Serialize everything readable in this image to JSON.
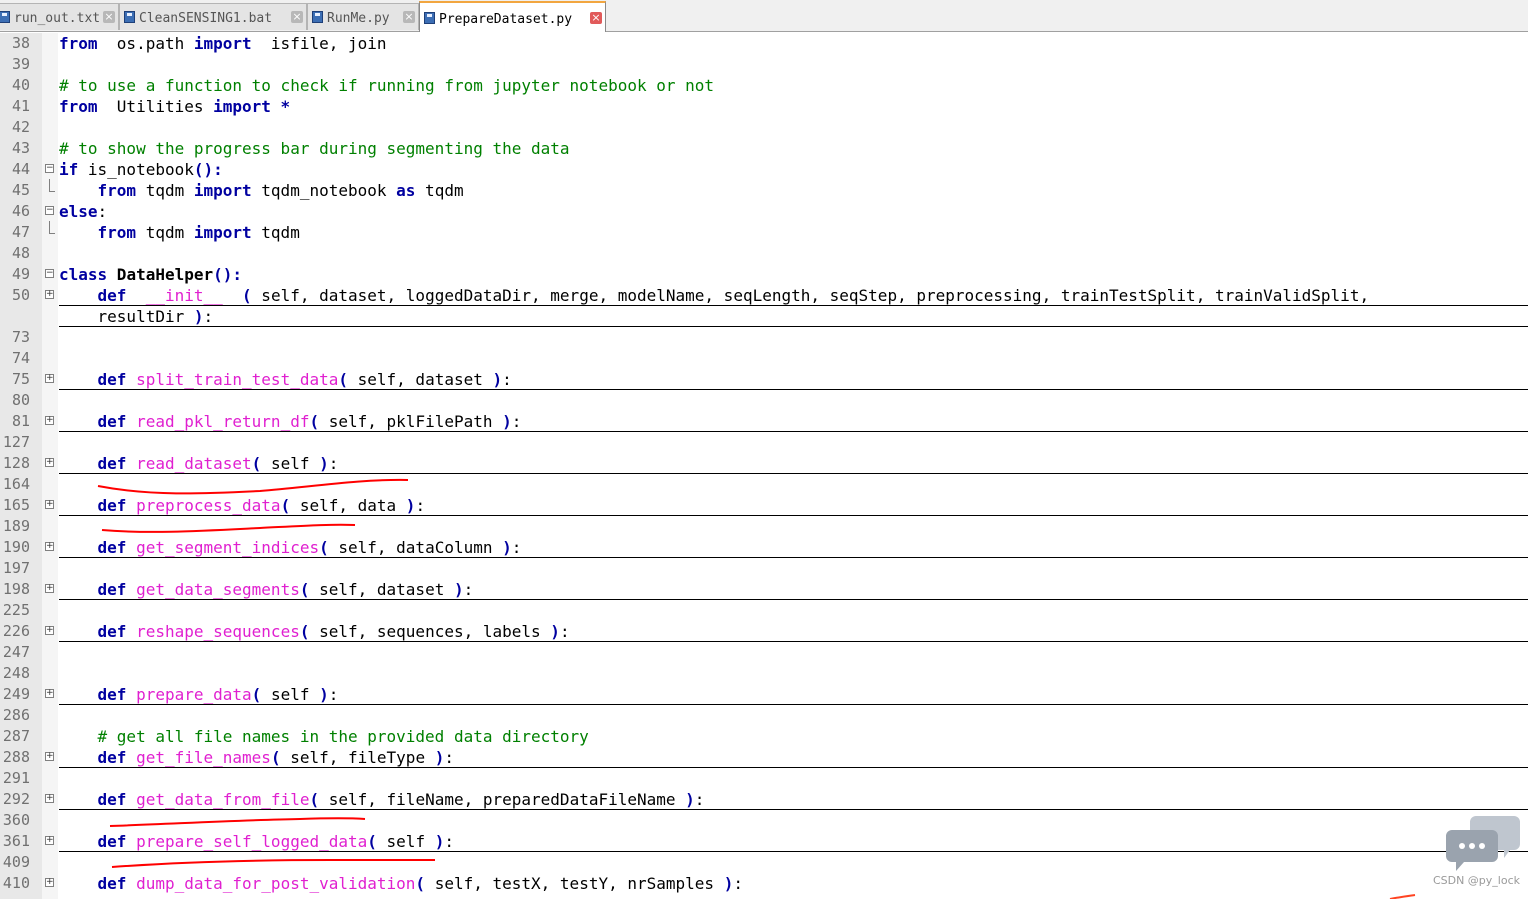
{
  "tabs": [
    {
      "label": "run_out.txt",
      "active": false
    },
    {
      "label": "CleanSENSING1.bat",
      "active": false
    },
    {
      "label": "RunMe.py",
      "active": false
    },
    {
      "label": "PrepareDataset.py",
      "active": true
    }
  ],
  "lines": [
    {
      "num": "38",
      "code": [
        [
          "kw",
          "from"
        ],
        [
          "",
          "  os.path "
        ],
        [
          "kw",
          "import"
        ],
        [
          "",
          "  isfile, join"
        ]
      ]
    },
    {
      "num": "39",
      "code": []
    },
    {
      "num": "40",
      "code": [
        [
          "cm",
          "# to use a function to check if running from jupyter notebook or not"
        ]
      ]
    },
    {
      "num": "41",
      "code": [
        [
          "kw",
          "from"
        ],
        [
          "",
          "  Utilities "
        ],
        [
          "kw",
          "import"
        ],
        [
          "",
          ""
        ],
        [
          "kw",
          " *"
        ]
      ]
    },
    {
      "num": "42",
      "code": []
    },
    {
      "num": "43",
      "code": [
        [
          "cm",
          "# to show the progress bar during segmenting the data"
        ]
      ]
    },
    {
      "num": "44",
      "fold": "open",
      "code": [
        [
          "kw",
          "if"
        ],
        [
          "",
          " is_notebook"
        ],
        [
          "kw",
          "():"
        ]
      ]
    },
    {
      "num": "45",
      "fold": "end",
      "code": [
        [
          "",
          "    "
        ],
        [
          "kw",
          "from"
        ],
        [
          "",
          " tqdm "
        ],
        [
          "kw",
          "import"
        ],
        [
          "",
          " tqdm_notebook "
        ],
        [
          "kw",
          "as"
        ],
        [
          "",
          " tqdm"
        ]
      ]
    },
    {
      "num": "46",
      "fold": "open",
      "code": [
        [
          "kw",
          "else"
        ],
        [
          "",
          ":"
        ]
      ]
    },
    {
      "num": "47",
      "fold": "end",
      "code": [
        [
          "",
          "    "
        ],
        [
          "kw",
          "from"
        ],
        [
          "",
          " tqdm "
        ],
        [
          "kw",
          "import"
        ],
        [
          "",
          " tqdm"
        ]
      ]
    },
    {
      "num": "48",
      "code": []
    },
    {
      "num": "49",
      "fold": "open",
      "code": [
        [
          "kw",
          "class"
        ],
        [
          "cls",
          " DataHelper"
        ],
        [
          "kw",
          "():"
        ]
      ]
    },
    {
      "num": "50",
      "fold": "closed",
      "sep": true,
      "code": [
        [
          "",
          "    "
        ],
        [
          "kw",
          "def"
        ],
        [
          "fn",
          "  __init__  "
        ],
        [
          "kw",
          "("
        ],
        [
          "",
          " self, dataset, loggedDataDir, merge, modelName, seqLength, seqStep, preprocessing, trainTestSplit, trainValidSplit,"
        ]
      ]
    },
    {
      "num": "",
      "sep": true,
      "code": [
        [
          "",
          "    resultDir "
        ],
        [
          "kw",
          ")"
        ],
        [
          "",
          ":"
        ]
      ]
    },
    {
      "num": "73",
      "code": []
    },
    {
      "num": "74",
      "code": []
    },
    {
      "num": "75",
      "fold": "closed",
      "sep": true,
      "code": [
        [
          "",
          "    "
        ],
        [
          "kw",
          "def"
        ],
        [
          "fn",
          " split_train_test_data"
        ],
        [
          "kw",
          "("
        ],
        [
          "",
          " self, dataset "
        ],
        [
          "kw",
          ")"
        ],
        [
          "",
          ":"
        ]
      ]
    },
    {
      "num": "80",
      "code": []
    },
    {
      "num": "81",
      "fold": "closed",
      "sep": true,
      "code": [
        [
          "",
          "    "
        ],
        [
          "kw",
          "def"
        ],
        [
          "fn",
          " read_pkl_return_df"
        ],
        [
          "kw",
          "("
        ],
        [
          "",
          " self, pklFilePath "
        ],
        [
          "kw",
          ")"
        ],
        [
          "",
          ":"
        ]
      ]
    },
    {
      "num": "127",
      "code": []
    },
    {
      "num": "128",
      "fold": "closed",
      "sep": true,
      "code": [
        [
          "",
          "    "
        ],
        [
          "kw",
          "def"
        ],
        [
          "fn",
          " read_dataset"
        ],
        [
          "kw",
          "("
        ],
        [
          "",
          " self "
        ],
        [
          "kw",
          ")"
        ],
        [
          "",
          ":"
        ]
      ]
    },
    {
      "num": "164",
      "code": []
    },
    {
      "num": "165",
      "fold": "closed",
      "sep": true,
      "code": [
        [
          "",
          "    "
        ],
        [
          "kw",
          "def"
        ],
        [
          "fn",
          " preprocess_data"
        ],
        [
          "kw",
          "("
        ],
        [
          "",
          " self, data "
        ],
        [
          "kw",
          ")"
        ],
        [
          "",
          ":"
        ]
      ]
    },
    {
      "num": "189",
      "code": []
    },
    {
      "num": "190",
      "fold": "closed",
      "sep": true,
      "code": [
        [
          "",
          "    "
        ],
        [
          "kw",
          "def"
        ],
        [
          "fn",
          " get_segment_indices"
        ],
        [
          "kw",
          "("
        ],
        [
          "",
          " self, dataColumn "
        ],
        [
          "kw",
          ")"
        ],
        [
          "",
          ":"
        ]
      ]
    },
    {
      "num": "197",
      "code": []
    },
    {
      "num": "198",
      "fold": "closed",
      "sep": true,
      "code": [
        [
          "",
          "    "
        ],
        [
          "kw",
          "def"
        ],
        [
          "fn",
          " get_data_segments"
        ],
        [
          "kw",
          "("
        ],
        [
          "",
          " self, dataset "
        ],
        [
          "kw",
          ")"
        ],
        [
          "",
          ":"
        ]
      ]
    },
    {
      "num": "225",
      "code": []
    },
    {
      "num": "226",
      "fold": "closed",
      "sep": true,
      "code": [
        [
          "",
          "    "
        ],
        [
          "kw",
          "def"
        ],
        [
          "fn",
          " reshape_sequences"
        ],
        [
          "kw",
          "("
        ],
        [
          "",
          " self, sequences, labels "
        ],
        [
          "kw",
          ")"
        ],
        [
          "",
          ":"
        ]
      ]
    },
    {
      "num": "247",
      "code": []
    },
    {
      "num": "248",
      "code": []
    },
    {
      "num": "249",
      "fold": "closed",
      "sep": true,
      "code": [
        [
          "",
          "    "
        ],
        [
          "kw",
          "def"
        ],
        [
          "fn",
          " prepare_data"
        ],
        [
          "kw",
          "("
        ],
        [
          "",
          " self "
        ],
        [
          "kw",
          ")"
        ],
        [
          "",
          ":"
        ]
      ]
    },
    {
      "num": "286",
      "code": []
    },
    {
      "num": "287",
      "code": [
        [
          "",
          "    "
        ],
        [
          "cm",
          "# get all file names in the provided data directory"
        ]
      ]
    },
    {
      "num": "288",
      "fold": "closed",
      "sep": true,
      "code": [
        [
          "",
          "    "
        ],
        [
          "kw",
          "def"
        ],
        [
          "fn",
          " get_file_names"
        ],
        [
          "kw",
          "("
        ],
        [
          "",
          " self, fileType "
        ],
        [
          "kw",
          ")"
        ],
        [
          "",
          ":"
        ]
      ]
    },
    {
      "num": "291",
      "code": []
    },
    {
      "num": "292",
      "fold": "closed",
      "sep": true,
      "code": [
        [
          "",
          "    "
        ],
        [
          "kw",
          "def"
        ],
        [
          "fn",
          " get_data_from_file"
        ],
        [
          "kw",
          "("
        ],
        [
          "",
          " self, fileName, preparedDataFileName "
        ],
        [
          "kw",
          ")"
        ],
        [
          "",
          ":"
        ]
      ]
    },
    {
      "num": "360",
      "code": []
    },
    {
      "num": "361",
      "fold": "closed",
      "sep": true,
      "code": [
        [
          "",
          "    "
        ],
        [
          "kw",
          "def"
        ],
        [
          "fn",
          " prepare_self_logged_data"
        ],
        [
          "kw",
          "("
        ],
        [
          "",
          " self "
        ],
        [
          "kw",
          ")"
        ],
        [
          "",
          ":"
        ]
      ]
    },
    {
      "num": "409",
      "code": []
    },
    {
      "num": "410",
      "fold": "closed",
      "code": [
        [
          "",
          "    "
        ],
        [
          "kw",
          "def"
        ],
        [
          "fn",
          " dump_data_for_post_validation"
        ],
        [
          "kw",
          "("
        ],
        [
          "",
          " self, testX, testY, nrSamples "
        ],
        [
          "kw",
          ")"
        ],
        [
          "",
          ":"
        ]
      ]
    }
  ],
  "watermark": "CSDN @py_lock",
  "colors": {
    "keyword": "#0000a0",
    "function": "#e020d0",
    "comment": "#008000",
    "annotation": "#ff0000"
  }
}
